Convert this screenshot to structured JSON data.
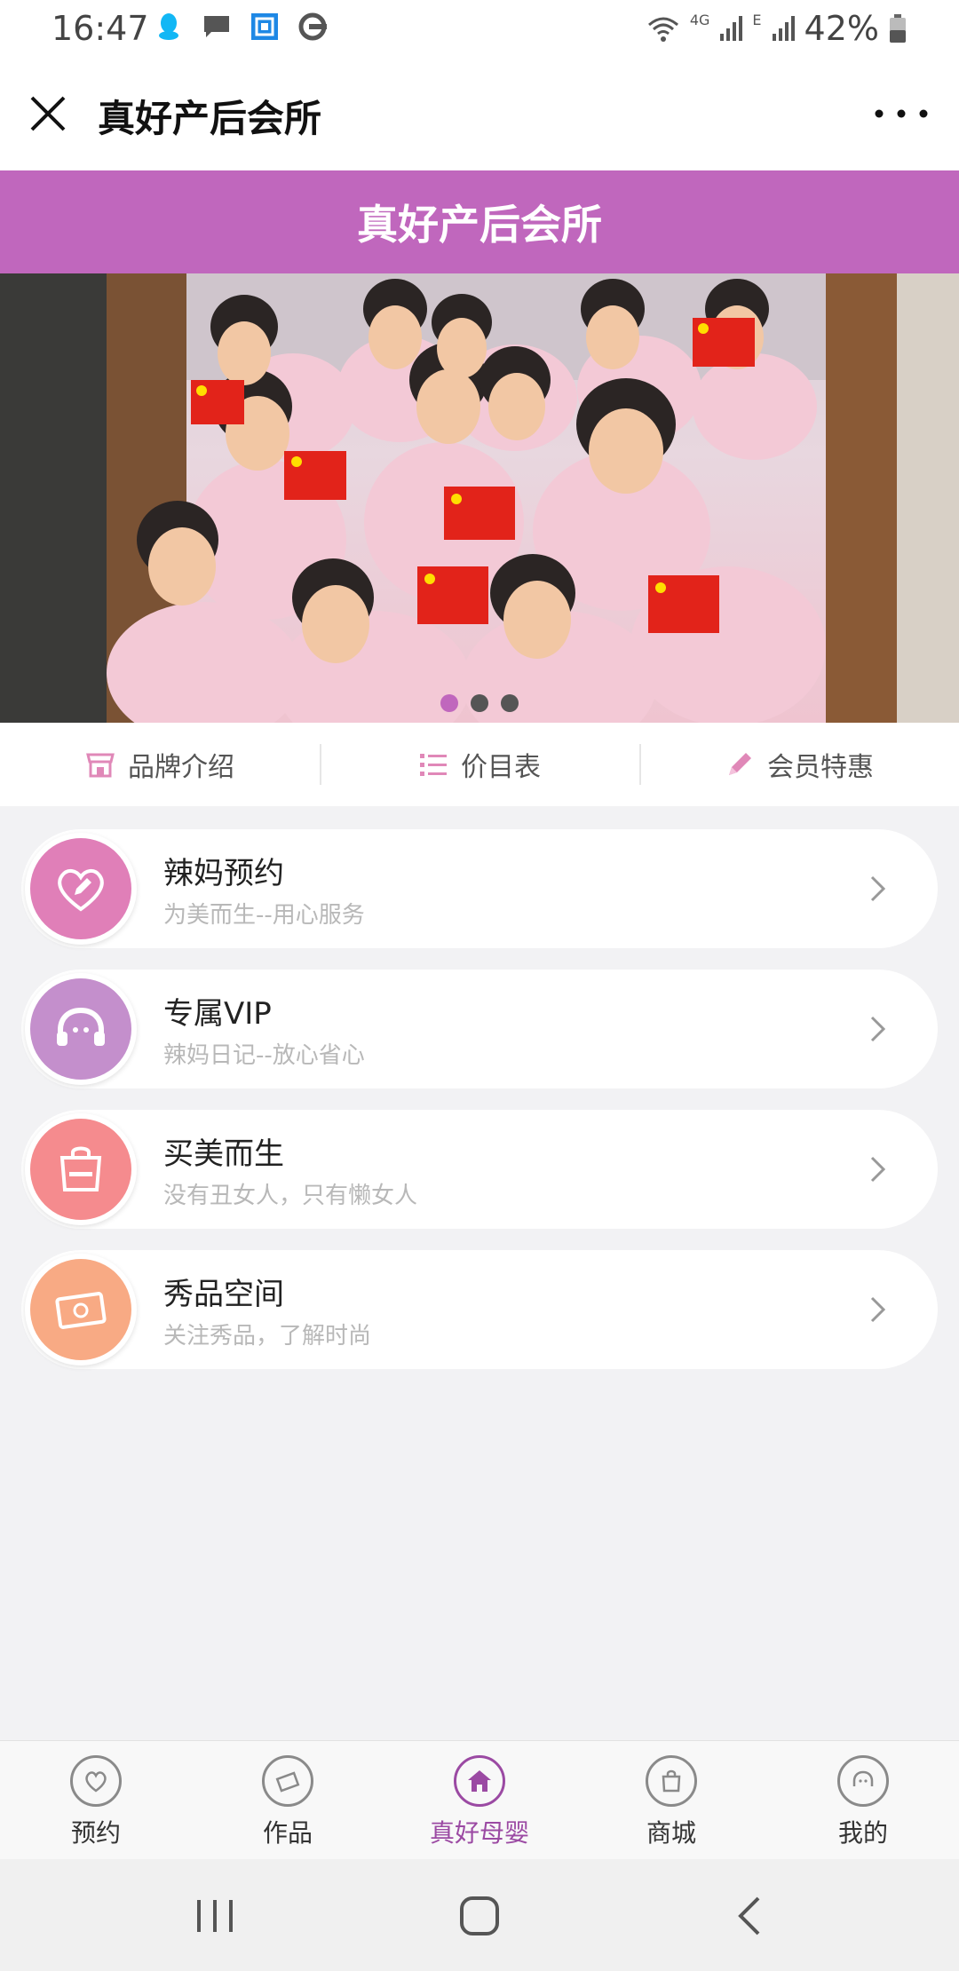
{
  "status_bar": {
    "time": "16:47",
    "network_4g": "4G",
    "network_e": "E",
    "battery": "42%",
    "left_icons": [
      "qq-icon",
      "message-icon",
      "app-r-icon",
      "browser-icon"
    ],
    "right_icons": [
      "wifi-icon",
      "signal-icon",
      "signal-icon",
      "battery-icon"
    ]
  },
  "title_bar": {
    "title": "真好产后会所",
    "close_icon": "close-icon",
    "more_icon": "more-icon"
  },
  "header": {
    "title": "真好产后会所",
    "background": "#c067bd"
  },
  "banner": {
    "dots": 3,
    "active_dot": 0
  },
  "quick_nav": [
    {
      "label": "品牌介绍",
      "icon": "store-icon"
    },
    {
      "label": "价目表",
      "icon": "list-icon"
    },
    {
      "label": "会员特惠",
      "icon": "pencil-icon"
    }
  ],
  "menu": [
    {
      "title": "辣妈预约",
      "subtitle": "为美而生--用心服务",
      "icon": "heart-pen-icon",
      "color": "#e07fb8"
    },
    {
      "title": "专属VIP",
      "subtitle": "辣妈日记--放心省心",
      "icon": "headset-icon",
      "color": "#c48fcc"
    },
    {
      "title": "买美而生",
      "subtitle": "没有丑女人，只有懒女人",
      "icon": "shopping-bag-icon",
      "color": "#f58b8e"
    },
    {
      "title": "秀品空间",
      "subtitle": "关注秀品，了解时尚",
      "icon": "ticket-icon",
      "color": "#f8aa84"
    }
  ],
  "tabs": [
    {
      "label": "预约",
      "icon": "appointment-icon",
      "active": false
    },
    {
      "label": "作品",
      "icon": "works-icon",
      "active": false
    },
    {
      "label": "真好母婴",
      "icon": "home-icon",
      "active": true
    },
    {
      "label": "商城",
      "icon": "shop-icon",
      "active": false
    },
    {
      "label": "我的",
      "icon": "profile-icon",
      "active": false
    }
  ],
  "accent": "#9b4aa3"
}
